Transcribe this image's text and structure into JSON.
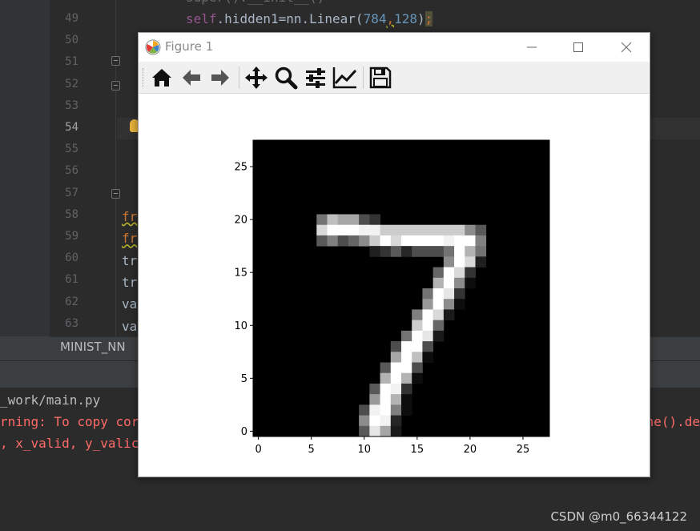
{
  "editor": {
    "line_numbers": [
      "49",
      "50",
      "51",
      "52",
      "53",
      "54",
      "55",
      "56",
      "57",
      "58",
      "59",
      "60",
      "61",
      "62",
      "63"
    ],
    "active_line": "54",
    "top_code": {
      "self": "self",
      "dot": ".",
      "attr": "hidden1=nn.Linear(",
      "arg1": "784",
      "comma": ",",
      "arg2": "128",
      "close": ")",
      "semi": ";"
    },
    "left_fragments": [
      "fr",
      "fr",
      "tr",
      "tr",
      "va",
      "va"
    ],
    "tab_label": "MINIST_NN"
  },
  "console": {
    "lines": [
      {
        "text": "_work/main.py",
        "color": "#bbbbbb"
      },
      {
        "text": "rning: To copy cor",
        "color": "#ff6b68"
      },
      {
        "text": ", x_valid, y_valic",
        "color": "#ff6b68"
      }
    ],
    "right_fragment": "ne().de"
  },
  "figure": {
    "title": "Figure 1",
    "toolbar": [
      {
        "name": "home-icon"
      },
      {
        "name": "back-arrow-icon"
      },
      {
        "name": "forward-arrow-icon"
      },
      {
        "name": "pan-move-icon"
      },
      {
        "name": "zoom-magnifier-icon"
      },
      {
        "name": "configure-subplots-icon"
      },
      {
        "name": "edit-axis-icon"
      },
      {
        "name": "save-floppy-icon"
      }
    ]
  },
  "chart_data": {
    "type": "heatmap",
    "title": "",
    "xlabel": "",
    "ylabel": "",
    "colormap": "gray",
    "xlim": [
      -0.5,
      27.5
    ],
    "ylim": [
      27.5,
      -0.5
    ],
    "x_ticks": [
      0,
      5,
      10,
      15,
      20,
      25
    ],
    "y_ticks": [
      0,
      5,
      10,
      15,
      20,
      25
    ],
    "shape": [
      28,
      28
    ],
    "pixels": [
      {
        "r": 7,
        "c": [
          6,
          7,
          8,
          9,
          10,
          11
        ],
        "v": [
          0.45,
          0.75,
          0.65,
          0.65,
          0.3,
          0.2
        ]
      },
      {
        "r": 8,
        "c": [
          6,
          7,
          8,
          9,
          10,
          11,
          12,
          13,
          14,
          15,
          16,
          17,
          18,
          19,
          20,
          21
        ],
        "v": [
          0.85,
          1,
          1,
          1,
          0.95,
          0.95,
          0.8,
          0.8,
          0.8,
          0.8,
          0.8,
          0.8,
          0.8,
          0.8,
          0.55,
          0.35
        ]
      },
      {
        "r": 9,
        "c": [
          6,
          7,
          8,
          9,
          10,
          11,
          12,
          13,
          14,
          15,
          16,
          17,
          18,
          19,
          20,
          21
        ],
        "v": [
          0.35,
          0.5,
          0.3,
          0.4,
          0.55,
          0.8,
          1,
          0.85,
          1,
          1,
          1,
          1,
          0.95,
          1,
          1,
          0.5
        ]
      },
      {
        "r": 10,
        "c": [
          11,
          12,
          13,
          14,
          15,
          16,
          17,
          18,
          19,
          20,
          21
        ],
        "v": [
          0.12,
          0.2,
          0.35,
          0.15,
          0.3,
          0.3,
          0.3,
          0.45,
          1,
          0.7,
          0.45
        ]
      },
      {
        "r": 11,
        "c": [
          18,
          19,
          20,
          21
        ],
        "v": [
          0.55,
          1,
          0.85,
          0.12
        ]
      },
      {
        "r": 12,
        "c": [
          17,
          18,
          19,
          20
        ],
        "v": [
          0.4,
          1,
          0.85,
          0.2
        ]
      },
      {
        "r": 13,
        "c": [
          17,
          18,
          19,
          20
        ],
        "v": [
          0.7,
          1,
          0.55,
          0.05
        ]
      },
      {
        "r": 14,
        "c": [
          16,
          17,
          18,
          19
        ],
        "v": [
          0.45,
          1,
          0.9,
          0.2
        ]
      },
      {
        "r": 15,
        "c": [
          16,
          17,
          18,
          19
        ],
        "v": [
          0.6,
          1,
          0.55,
          0.05
        ]
      },
      {
        "r": 16,
        "c": [
          15,
          16,
          17,
          18
        ],
        "v": [
          0.5,
          1,
          0.85,
          0.1
        ]
      },
      {
        "r": 17,
        "c": [
          15,
          16,
          17
        ],
        "v": [
          0.8,
          1,
          0.4
        ]
      },
      {
        "r": 18,
        "c": [
          14,
          15,
          16,
          17
        ],
        "v": [
          0.45,
          1,
          0.9,
          0.1
        ]
      },
      {
        "r": 19,
        "c": [
          13,
          14,
          15,
          16
        ],
        "v": [
          0.3,
          1,
          1,
          0.3
        ]
      },
      {
        "r": 20,
        "c": [
          13,
          14,
          15,
          16
        ],
        "v": [
          0.65,
          1,
          0.75,
          0.05
        ]
      },
      {
        "r": 21,
        "c": [
          12,
          13,
          14,
          15
        ],
        "v": [
          0.35,
          1,
          1,
          0.3
        ]
      },
      {
        "r": 22,
        "c": [
          12,
          13,
          14,
          15
        ],
        "v": [
          0.7,
          1,
          0.7,
          0.05
        ]
      },
      {
        "r": 23,
        "c": [
          11,
          12,
          13,
          14
        ],
        "v": [
          0.35,
          1,
          0.95,
          0.2
        ]
      },
      {
        "r": 24,
        "c": [
          11,
          12,
          13,
          14
        ],
        "v": [
          0.6,
          1,
          0.7,
          0.05
        ]
      },
      {
        "r": 25,
        "c": [
          10,
          11,
          12,
          13,
          14
        ],
        "v": [
          0.3,
          0.95,
          1,
          0.5,
          0.05
        ]
      },
      {
        "r": 26,
        "c": [
          10,
          11,
          12,
          13
        ],
        "v": [
          0.55,
          1,
          0.95,
          0.15
        ]
      },
      {
        "r": 27,
        "c": [
          10,
          11,
          12,
          13
        ],
        "v": [
          0.35,
          0.9,
          0.65,
          0.1
        ]
      }
    ]
  },
  "watermark": "CSDN @m0_66344122",
  "colors": {
    "editor_bg": "#2b2b2b",
    "gutter_bg": "#313335",
    "panel_bg": "#3c3f41",
    "error_red": "#ff6b68",
    "self_purple": "#94558d",
    "number_blue": "#6897bb"
  }
}
